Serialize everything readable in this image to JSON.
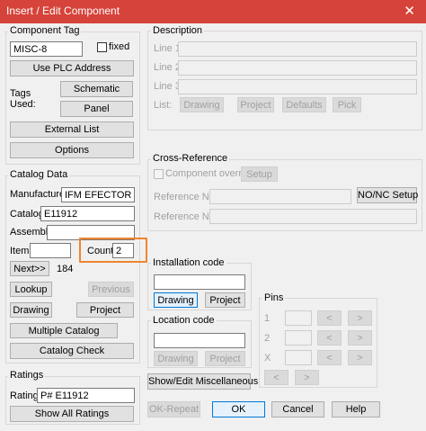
{
  "window": {
    "title": "Insert / Edit Component",
    "close_glyph": "✕"
  },
  "component_tag": {
    "group_label": "Component Tag",
    "tag_value": "MISC-8",
    "fixed_label": "fixed",
    "use_plc_label": "Use PLC Address",
    "tags_used_label": "Tags\nUsed:",
    "schematic_label": "Schematic",
    "panel_label": "Panel",
    "external_list_label": "External List",
    "options_label": "Options"
  },
  "catalog": {
    "group_label": "Catalog Data",
    "manufacturer_label": "Manufacturer",
    "manufacturer_value": "IFM EFECTOR",
    "catalog_label": "Catalog",
    "catalog_value": "E11912",
    "assembly_label": "Assembly",
    "assembly_value": "",
    "item_label": "Item",
    "item_value": "",
    "count_label": "Count",
    "count_value": "2",
    "next_label": "Next>>",
    "next_number": "184",
    "lookup_label": "Lookup",
    "previous_label": "Previous",
    "drawing_label": "Drawing",
    "project_label": "Project",
    "multiple_catalog_label": "Multiple Catalog",
    "catalog_check_label": "Catalog Check"
  },
  "ratings": {
    "group_label": "Ratings",
    "rating_label": "Rating",
    "rating_value": "P# E11912",
    "show_all_label": "Show All Ratings"
  },
  "description": {
    "group_label": "Description",
    "line1_label": "Line 1",
    "line2_label": "Line 2",
    "line3_label": "Line 3",
    "list_label": "List:",
    "drawing_label": "Drawing",
    "project_label": "Project",
    "defaults_label": "Defaults",
    "pick_label": "Pick"
  },
  "cross_reference": {
    "group_label": "Cross-Reference",
    "override_label": "Component override",
    "setup_label": "Setup",
    "ref_no_label": "Reference NO",
    "nonc_setup_label": "NO/NC Setup",
    "ref_nc_label": "Reference NC"
  },
  "installation": {
    "group_label": "Installation code",
    "value": "",
    "drawing_label": "Drawing",
    "project_label": "Project"
  },
  "location": {
    "group_label": "Location code",
    "value": "",
    "drawing_label": "Drawing",
    "project_label": "Project"
  },
  "pins": {
    "group_label": "Pins",
    "row1_label": "1",
    "row2_label": "2",
    "row3_label": "X",
    "prev_glyph": "<",
    "next_glyph": ">"
  },
  "footer": {
    "show_edit_misc_label": "Show/Edit Miscellaneous",
    "ok_repeat_label": "OK-Repeat",
    "ok_label": "OK",
    "cancel_label": "Cancel",
    "help_label": "Help"
  }
}
